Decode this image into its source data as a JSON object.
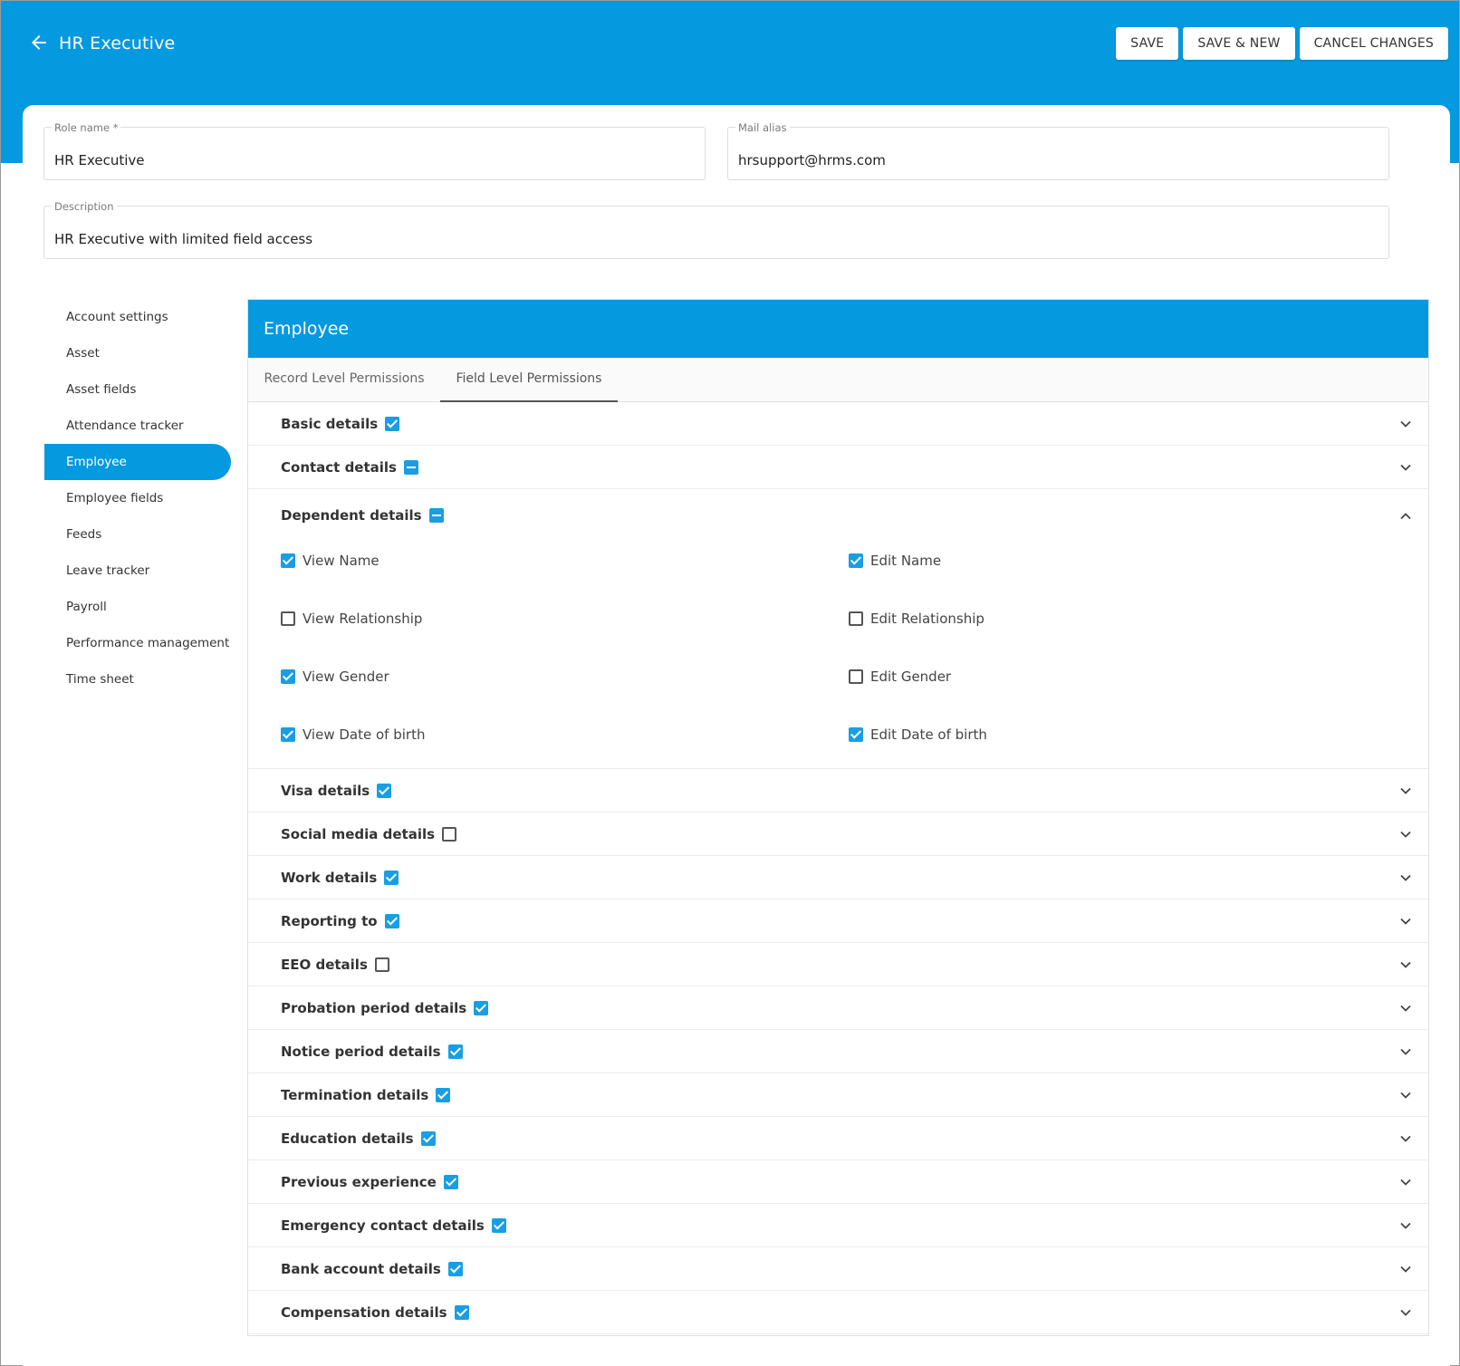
{
  "header": {
    "back_icon": "arrow-left-icon",
    "title": "HR Executive",
    "buttons": {
      "save": "SAVE",
      "save_new": "SAVE & NEW",
      "cancel": "CANCEL CHANGES"
    }
  },
  "form": {
    "role_name": {
      "label": "Role name *",
      "value": "HR Executive"
    },
    "mail_alias": {
      "label": "Mail alias",
      "value": "hrsupport@hrms.com"
    },
    "description": {
      "label": "Description",
      "value": "HR Executive with limited field access"
    }
  },
  "sidebar": {
    "items": [
      {
        "label": "Account settings",
        "active": false
      },
      {
        "label": "Asset",
        "active": false
      },
      {
        "label": "Asset fields",
        "active": false
      },
      {
        "label": "Attendance tracker",
        "active": false
      },
      {
        "label": "Employee",
        "active": true
      },
      {
        "label": "Employee fields",
        "active": false
      },
      {
        "label": "Feeds",
        "active": false
      },
      {
        "label": "Leave tracker",
        "active": false
      },
      {
        "label": "Payroll",
        "active": false
      },
      {
        "label": "Performance management",
        "active": false
      },
      {
        "label": "Time sheet",
        "active": false
      }
    ]
  },
  "panel": {
    "title": "Employee",
    "tabs": [
      {
        "label": "Record Level Permissions",
        "active": false
      },
      {
        "label": "Field Level Permissions",
        "active": true
      }
    ],
    "sections_before": [
      {
        "label": "Basic details",
        "state": "checked"
      },
      {
        "label": "Contact details",
        "state": "indeterminate"
      }
    ],
    "expanded_section": {
      "label": "Dependent details",
      "state": "indeterminate",
      "permissions": [
        {
          "view": {
            "label": "View Name",
            "checked": true
          },
          "edit": {
            "label": "Edit Name",
            "checked": true
          }
        },
        {
          "view": {
            "label": "View Relationship",
            "checked": false
          },
          "edit": {
            "label": "Edit Relationship",
            "checked": false
          }
        },
        {
          "view": {
            "label": "View Gender",
            "checked": true
          },
          "edit": {
            "label": "Edit Gender",
            "checked": false
          }
        },
        {
          "view": {
            "label": "View Date of birth",
            "checked": true
          },
          "edit": {
            "label": "Edit Date of birth",
            "checked": true
          }
        }
      ]
    },
    "sections_after": [
      {
        "label": "Visa details",
        "state": "checked"
      },
      {
        "label": "Social media details",
        "state": "unchecked"
      },
      {
        "label": "Work details",
        "state": "checked"
      },
      {
        "label": "Reporting to",
        "state": "checked"
      },
      {
        "label": "EEO details",
        "state": "unchecked"
      },
      {
        "label": "Probation period details",
        "state": "checked"
      },
      {
        "label": "Notice period details",
        "state": "checked"
      },
      {
        "label": "Termination details",
        "state": "checked"
      },
      {
        "label": "Education details",
        "state": "checked"
      },
      {
        "label": "Previous experience",
        "state": "checked"
      },
      {
        "label": "Emergency contact details",
        "state": "checked"
      },
      {
        "label": "Bank account details",
        "state": "checked"
      },
      {
        "label": "Compensation details",
        "state": "checked"
      }
    ]
  },
  "colors": {
    "primary": "#0599e0",
    "checkbox": "#1a9ee3"
  }
}
